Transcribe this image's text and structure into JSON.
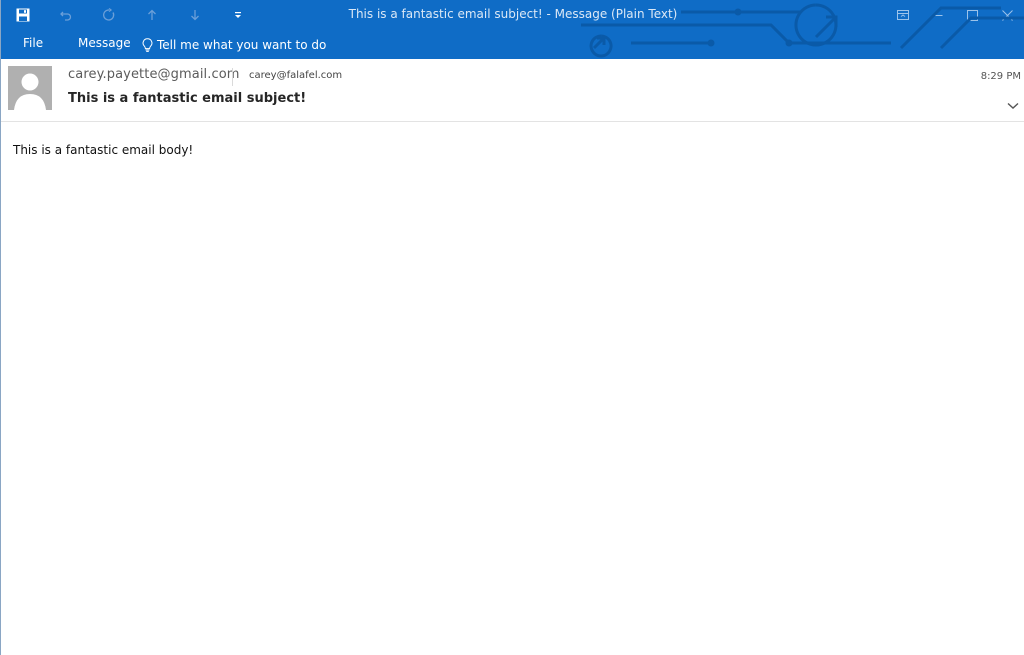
{
  "window": {
    "title": "This is a fantastic email subject!  -  Message (Plain Text)",
    "accent_color": "#0f6cc6"
  },
  "quick_access": {
    "items": [
      {
        "icon": "save-icon"
      },
      {
        "icon": "undo-icon"
      },
      {
        "icon": "redo-icon"
      },
      {
        "icon": "previous-item-icon"
      },
      {
        "icon": "next-item-icon"
      },
      {
        "icon": "customize-dropdown-icon"
      }
    ]
  },
  "window_controls": {
    "items": [
      {
        "icon": "ribbon-display-options-icon"
      },
      {
        "icon": "minimize-icon"
      },
      {
        "icon": "maximize-icon"
      },
      {
        "icon": "close-icon"
      }
    ]
  },
  "ribbon": {
    "tabs": [
      {
        "label": "File"
      },
      {
        "label": "Message"
      }
    ],
    "tell_me": "Tell me what you want to do"
  },
  "message": {
    "from": "carey.payette@gmail.com",
    "to": "carey@falafel.com",
    "subject": "This is a fantastic email subject!",
    "time": "8:29 PM",
    "body": "This is a fantastic email body!"
  }
}
